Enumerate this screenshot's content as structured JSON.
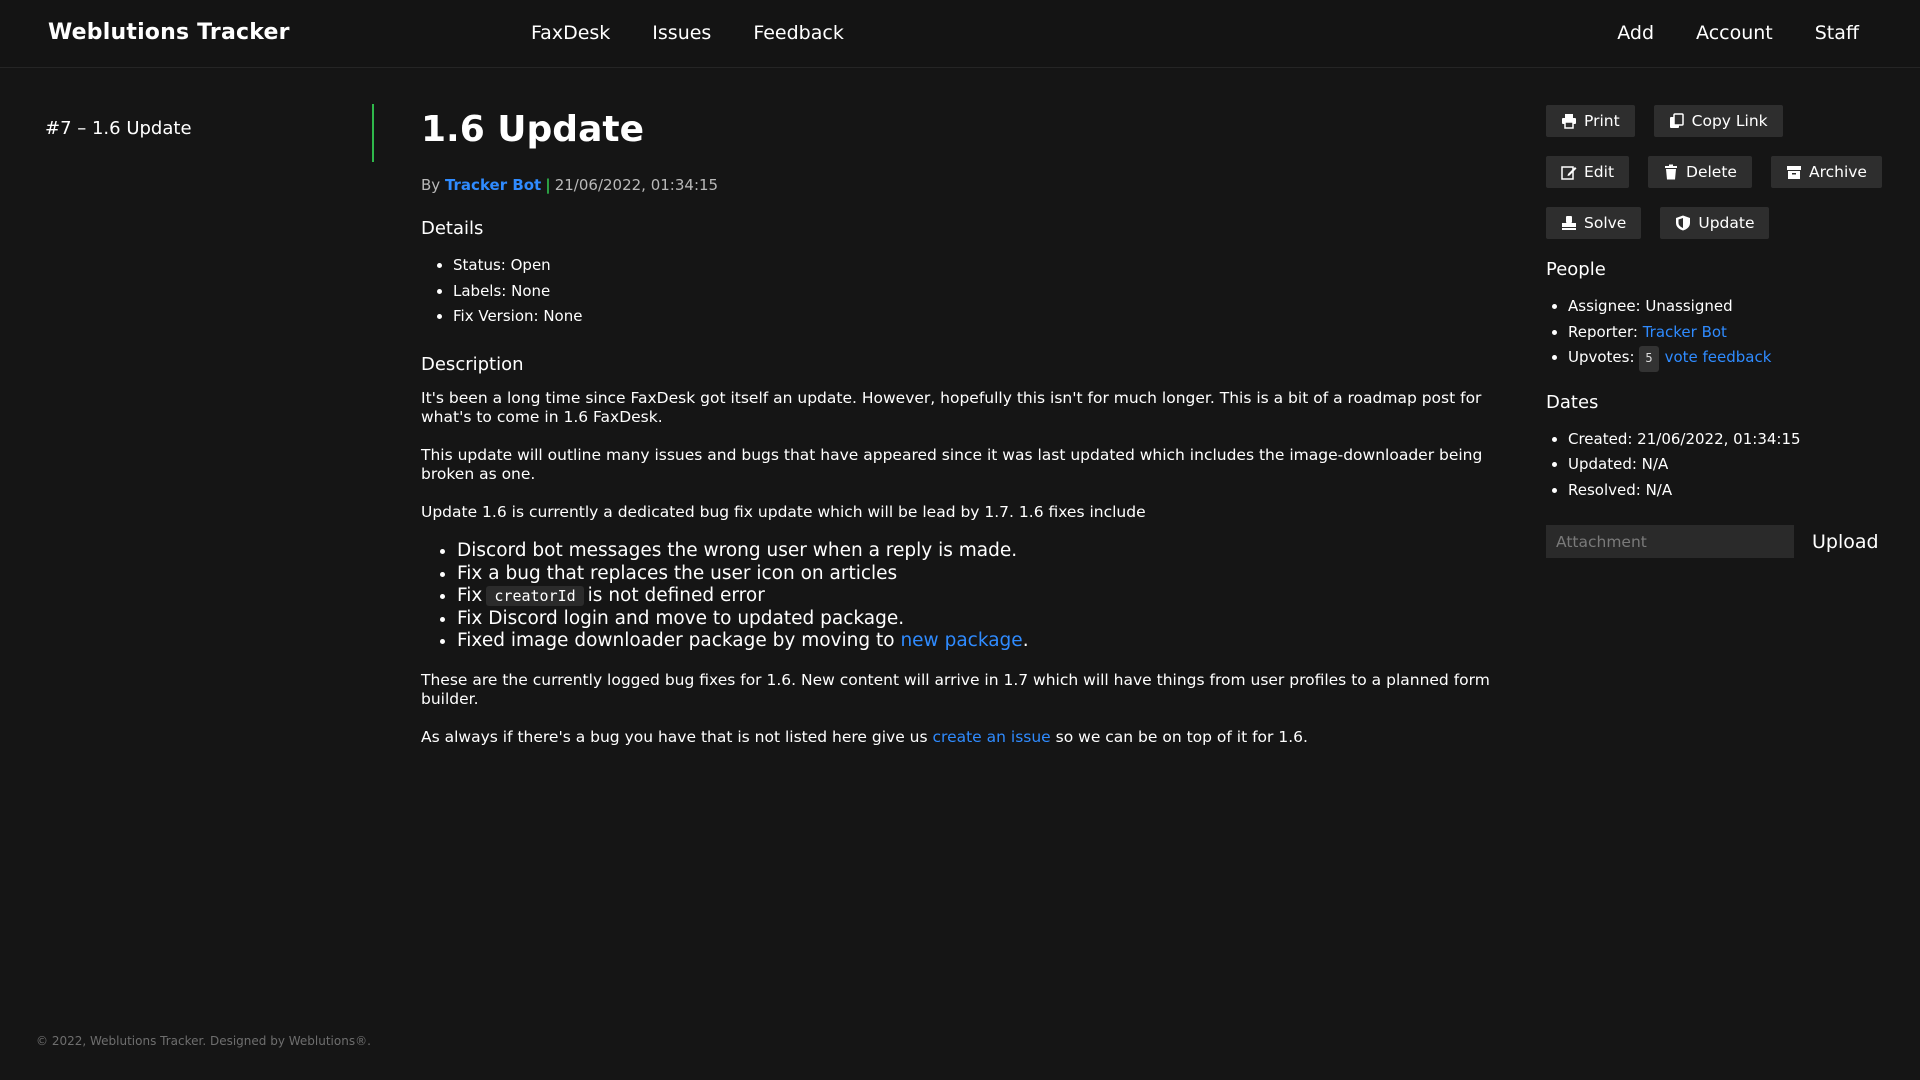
{
  "header": {
    "brand": "Weblutions Tracker",
    "nav_center": [
      "FaxDesk",
      "Issues",
      "Feedback"
    ],
    "nav_right": [
      "Add",
      "Account",
      "Staff"
    ]
  },
  "sidebar": {
    "item_label": "#7 – 1.6 Update",
    "accent_color": "#2fb84b"
  },
  "issue": {
    "title": "1.6 Update",
    "by_label": "By",
    "author": "Tracker Bot",
    "separator": "|",
    "date": "21/06/2022, 01:34:15",
    "details_heading": "Details",
    "details": [
      "Status: Open",
      "Labels: None",
      "Fix Version: None"
    ],
    "description_heading": "Description",
    "paragraphs": [
      "It's been a long time since FaxDesk got itself an update. However, hopefully this isn't for much longer. This is a bit of a roadmap post for what's to come in 1.6 FaxDesk.",
      "This update will outline many issues and bugs that have appeared since it was last updated which includes the image-downloader being broken as one.",
      "Update 1.6 is currently a dedicated bug fix update which will be lead by 1.7. 1.6 fixes include"
    ],
    "fixes": {
      "item1": "Discord bot messages the wrong user when a reply is made.",
      "item2": "Fix a bug that replaces the user icon on articles",
      "item3_before": "Fix",
      "item3_code": "creatorId",
      "item3_after": "is not defined error",
      "item4": "Fix Discord login and move to updated package.",
      "item5_before": "Fixed image downloader package by moving to",
      "item5_link": "new package",
      "item5_after": "."
    },
    "closing_paragraph": "These are the currently logged bug fixes for 1.6. New content will arrive in 1.7 which will have things from user profiles to a planned form builder.",
    "last_before": "As always if there's a bug you have that is not listed here give us",
    "last_link": "create an issue",
    "last_after": "so we can be on top of it for 1.6."
  },
  "actions": {
    "print": "Print",
    "copy_link": "Copy Link",
    "edit": "Edit",
    "delete": "Delete",
    "archive": "Archive",
    "solve": "Solve",
    "update": "Update"
  },
  "people": {
    "heading": "People",
    "assignee": "Assignee: Unassigned",
    "reporter_label": "Reporter:",
    "reporter": "Tracker Bot",
    "upvotes_label": "Upvotes:",
    "upvotes_count": "5",
    "vote_link": "vote feedback"
  },
  "dates": {
    "heading": "Dates",
    "created": "Created: 21/06/2022, 01:34:15",
    "updated": "Updated: N/A",
    "resolved": "Resolved: N/A"
  },
  "upload": {
    "placeholder": "Attachment",
    "button": "Upload"
  },
  "footer": {
    "text": "© 2022, Weblutions Tracker. Designed by Weblutions®."
  },
  "colors": {
    "background": "#151515",
    "link": "#2f8bff",
    "accent": "#2fb84b",
    "button": "#2e2e2e"
  }
}
